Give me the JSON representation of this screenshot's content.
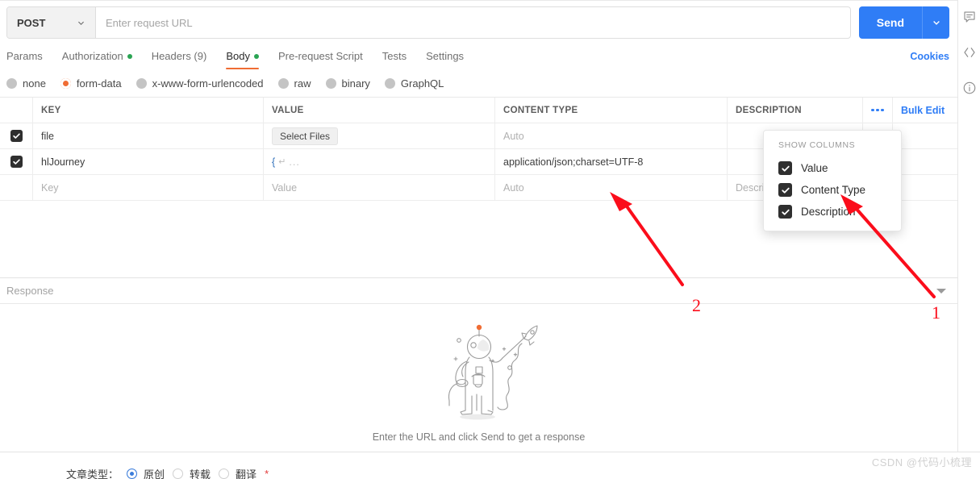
{
  "request": {
    "method": "POST",
    "url_value": "",
    "url_placeholder": "Enter request URL",
    "send_label": "Send"
  },
  "tabs": {
    "items": [
      {
        "label": "Params",
        "active": false,
        "dot": false
      },
      {
        "label": "Authorization",
        "active": false,
        "dot": true
      },
      {
        "label": "Headers (9)",
        "active": false,
        "dot": false
      },
      {
        "label": "Body",
        "active": true,
        "dot": true
      },
      {
        "label": "Pre-request Script",
        "active": false,
        "dot": false
      },
      {
        "label": "Tests",
        "active": false,
        "dot": false
      },
      {
        "label": "Settings",
        "active": false,
        "dot": false
      }
    ],
    "cookies_label": "Cookies"
  },
  "body_types": {
    "items": [
      {
        "label": "none",
        "selected": false
      },
      {
        "label": "form-data",
        "selected": true
      },
      {
        "label": "x-www-form-urlencoded",
        "selected": false
      },
      {
        "label": "raw",
        "selected": false
      },
      {
        "label": "binary",
        "selected": false
      },
      {
        "label": "GraphQL",
        "selected": false
      }
    ]
  },
  "table": {
    "headers": {
      "key": "KEY",
      "value": "VALUE",
      "content_type": "CONTENT TYPE",
      "description": "DESCRIPTION",
      "bulk_edit": "Bulk Edit"
    },
    "rows": [
      {
        "checked": true,
        "key": "file",
        "value_kind": "file-button",
        "value": "Select Files",
        "content_type": "Auto",
        "content_type_placeholder": true,
        "description": ""
      },
      {
        "checked": true,
        "key": "hlJourney",
        "value_kind": "json-collapsed",
        "value": "{",
        "value_suffix": "...",
        "content_type": "application/json;charset=UTF-8",
        "content_type_placeholder": false,
        "description": ""
      },
      {
        "checked": false,
        "key": "Key",
        "key_placeholder": true,
        "value_kind": "text",
        "value": "Value",
        "value_placeholder": true,
        "content_type": "Auto",
        "content_type_placeholder": true,
        "description": "Description",
        "description_placeholder": true
      }
    ]
  },
  "columns_popup": {
    "title": "SHOW COLUMNS",
    "items": [
      {
        "label": "Value",
        "checked": true
      },
      {
        "label": "Content Type",
        "checked": true
      },
      {
        "label": "Description",
        "checked": true
      }
    ]
  },
  "response": {
    "label": "Response",
    "empty_hint": "Enter the URL and click Send to get a response"
  },
  "annotations": {
    "markers": [
      {
        "label": "2"
      },
      {
        "label": "1"
      }
    ]
  },
  "background_page": {
    "field_label": "文章类型：",
    "options": [
      {
        "label": "原创",
        "selected": true
      },
      {
        "label": "转载",
        "selected": false
      },
      {
        "label": "翻译",
        "selected": false
      }
    ],
    "required_mark": "*"
  },
  "watermark": {
    "text": "CSDN @代码小梳理"
  },
  "colors": {
    "accent_blue": "#2f7df6",
    "active_tab_underline": "#f06c33",
    "form_data_radio": "#f06c33",
    "dot_green": "#2aa453",
    "annotation_red": "#fb0d1b"
  }
}
